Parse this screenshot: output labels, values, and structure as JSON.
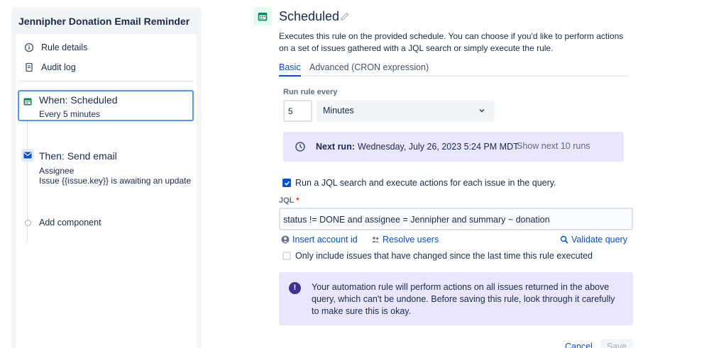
{
  "sidebar": {
    "rule_title": "Jennipher Donation Email Reminder",
    "nav": [
      {
        "label": "Rule details",
        "icon": "info-icon"
      },
      {
        "label": "Audit log",
        "icon": "document-icon"
      }
    ],
    "trigger": {
      "title": "When: Scheduled",
      "subtitle": "Every 5 minutes",
      "icon": "calendar-icon"
    },
    "action": {
      "title": "Then: Send email",
      "line1": "Assignee",
      "line2": "Issue {{issue.key}} is awaiting an update",
      "icon": "mail-icon"
    },
    "add_component": "Add component"
  },
  "main": {
    "title": "Scheduled",
    "description": "Executes this rule on the provided schedule. You can choose if you'd like to perform actions on a set of issues gathered with a JQL search or simply execute the rule.",
    "tabs": [
      {
        "label": "Basic",
        "active": true
      },
      {
        "label": "Advanced (CRON expression)",
        "active": false
      }
    ],
    "run_label": "Run rule every",
    "interval_value": "5",
    "interval_unit": "Minutes",
    "next_run": {
      "label": "Next run:",
      "value": "Wednesday, July 26, 2023 5:24 PM MDT",
      "link": "Show next 10 runs"
    },
    "jql_checkbox": {
      "label": "Run a JQL search and execute actions for each issue in the query.",
      "checked": true
    },
    "jql_label": "JQL",
    "jql_required": "*",
    "jql_value": "status != DONE and assignee = Jennipher and summary ~ donation",
    "links": {
      "insert_account": "Insert account id",
      "resolve_users": "Resolve users",
      "validate": "Validate query"
    },
    "changed_checkbox": {
      "label": "Only include issues that have changed since the last time this rule executed",
      "checked": false
    },
    "warning": "Your automation rule will perform actions on all issues returned in the above query, which can't be undone. Before saving this rule, look through it carefully to make sure this is okay.",
    "cancel": "Cancel",
    "save": "Save"
  },
  "colors": {
    "accent": "#0052cc",
    "selected_border": "#4c9aff",
    "info_bg": "#eae6ff",
    "warning_icon": "#403294"
  }
}
